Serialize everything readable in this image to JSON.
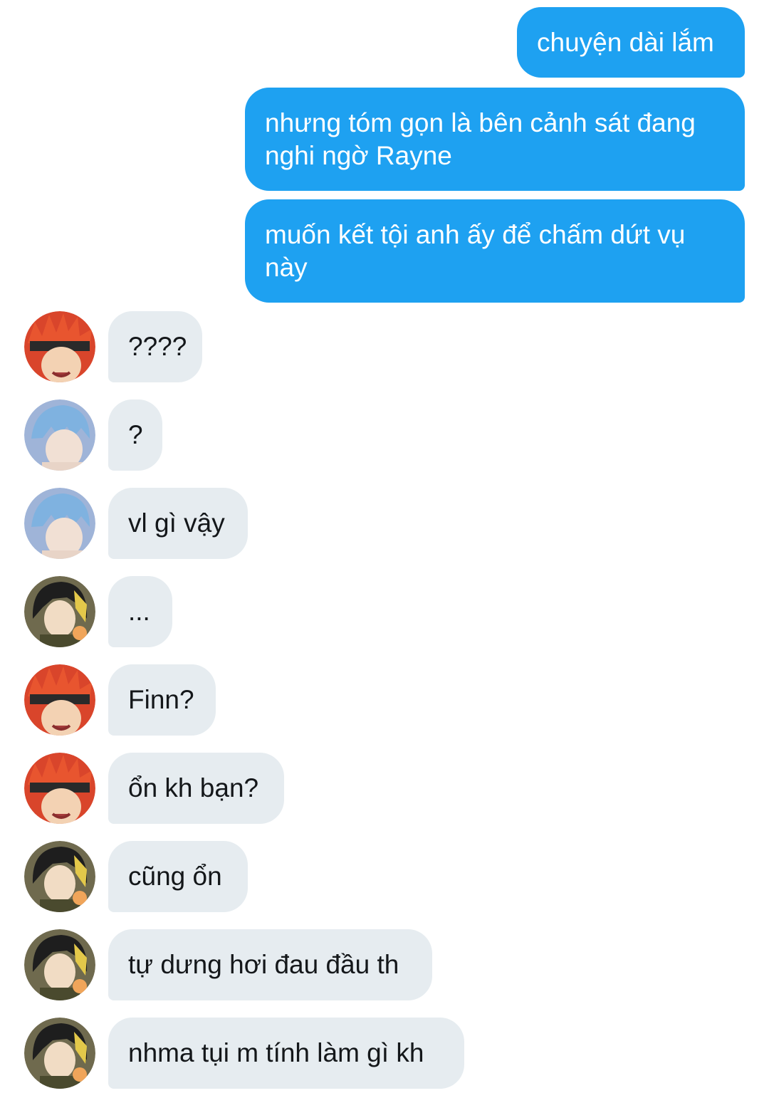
{
  "messages": [
    {
      "side": "out",
      "text": "chuyện dài lắm"
    },
    {
      "side": "out",
      "text": "nhưng tóm gọn là bên cảnh sát đang nghi ngờ Rayne"
    },
    {
      "side": "out",
      "text": "muốn kết tội anh ấy để chấm dứt vụ này"
    },
    {
      "side": "in",
      "avatar": "red-hair-avatar",
      "text": "????"
    },
    {
      "side": "in",
      "avatar": "blue-hair-avatar",
      "text": "?"
    },
    {
      "side": "in",
      "avatar": "blue-hair-avatar",
      "text": "vl gì vậy"
    },
    {
      "side": "in",
      "avatar": "dark-hair-avatar",
      "text": "..."
    },
    {
      "side": "in",
      "avatar": "red-hair-avatar",
      "text": "Finn?"
    },
    {
      "side": "in",
      "avatar": "red-hair-avatar",
      "text": "ổn kh bạn?"
    },
    {
      "side": "in",
      "avatar": "dark-hair-avatar",
      "text": "cũng ổn"
    },
    {
      "side": "in",
      "avatar": "dark-hair-avatar",
      "text": "tự dưng hơi đau đầu th"
    },
    {
      "side": "in",
      "avatar": "dark-hair-avatar",
      "text": "nhma tụi m tính làm gì kh"
    }
  ],
  "colors": {
    "outgoing_bubble": "#1ea1f1",
    "incoming_bubble": "#e6ecf0",
    "incoming_text": "#14171a",
    "background": "#ffffff"
  }
}
